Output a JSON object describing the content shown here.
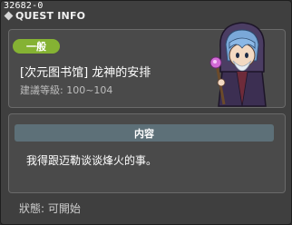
{
  "window": {
    "quest_id": "32682-0",
    "title": "QUEST INFO"
  },
  "summary": {
    "badge": "一般",
    "quest_name": "[次元图书馆] 龙神的安排",
    "level_label": "建議等級:",
    "level_range": "100~104"
  },
  "content": {
    "header": "内容",
    "text": "我得跟迈勒谈谈烽火的事。"
  },
  "status": {
    "label": "狀態:",
    "value": "可開始"
  },
  "colors": {
    "badge": "#85b233",
    "header": "#5d7078",
    "panel": "#4a4a4a",
    "window": "#3f3f3f"
  },
  "icons": {
    "npc": "mage-npc-portrait"
  }
}
